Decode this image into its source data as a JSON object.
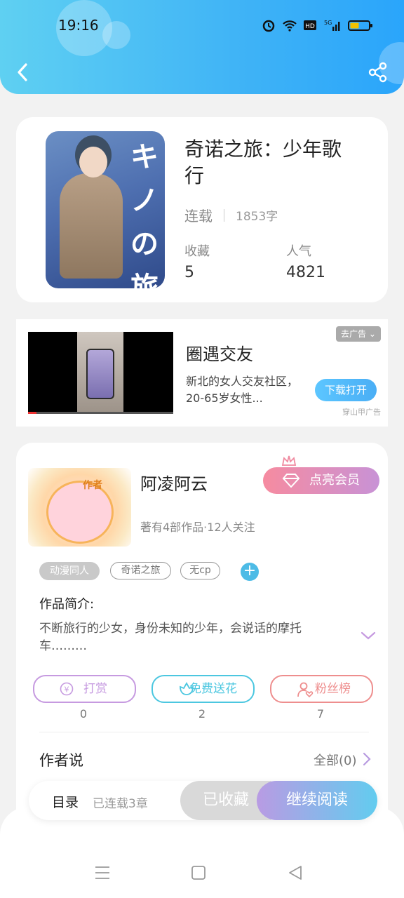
{
  "status_bar": {
    "time": "19:16"
  },
  "book": {
    "title": "奇诺之旅：少年歌行",
    "status": "连载",
    "word_count": "1853字",
    "favorites_label": "收藏",
    "favorites_value": "5",
    "popularity_label": "人气",
    "popularity_value": "4821"
  },
  "ad": {
    "title": "圈遇交友",
    "description": "新北的女人交友社区，20-65岁女性...",
    "button": "下载打开",
    "close_label": "去广告",
    "source": "穿山甲广告"
  },
  "author": {
    "name": "阿凌阿云",
    "info": "著有4部作品·12人关注",
    "vip_button": "点亮会员",
    "avatar_badge": "作者"
  },
  "tags": [
    "动漫同人",
    "奇诺之旅",
    "无cp"
  ],
  "intro": {
    "label": "作品简介:",
    "text": "不断旅行的少女，身份未知的少年，会说话的摩托车………"
  },
  "actions": [
    {
      "label": "打赏",
      "count": "0",
      "color": "#c69ae0"
    },
    {
      "label": "免费送花",
      "count": "2",
      "color": "#4cc7e0"
    },
    {
      "label": "粉丝榜",
      "count": "7",
      "color": "#ee8e8e"
    }
  ],
  "author_say": {
    "title": "作者说",
    "all_label": "全部(0)"
  },
  "bottom_bar": {
    "toc": "目录",
    "chapters": "已连载3章",
    "collected": "已收藏",
    "continue": "继续阅读"
  },
  "colors": {
    "header": "#3fb3f6",
    "accent_blue": "#4dbbe6",
    "vip_pink": "#f68ba0",
    "vip_purple": "#c892d6"
  }
}
